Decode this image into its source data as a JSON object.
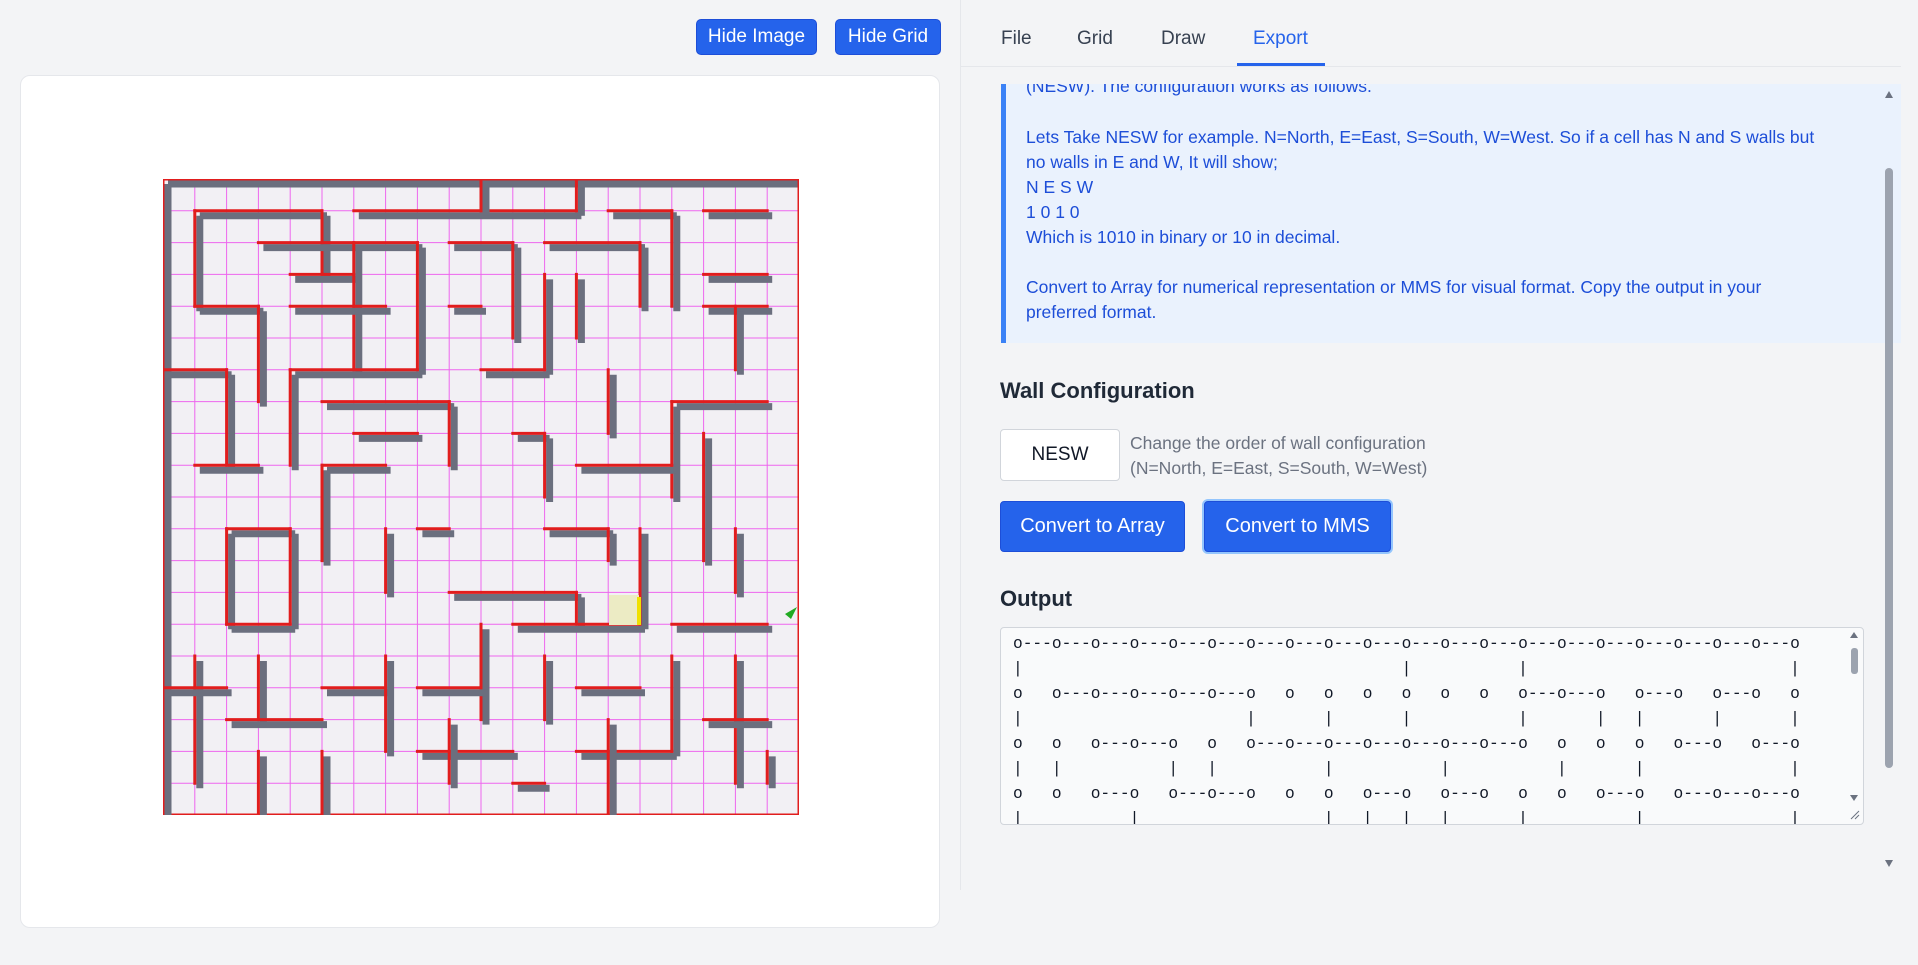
{
  "toolbar": {
    "hide_image_label": "Hide Image",
    "hide_grid_label": "Hide Grid"
  },
  "tabs": [
    {
      "label": "File",
      "active": false
    },
    {
      "label": "Grid",
      "active": false
    },
    {
      "label": "Draw",
      "active": false
    },
    {
      "label": "Export",
      "active": true
    }
  ],
  "info": {
    "line_clipped": "(NESW). The configuration works as follows.",
    "para1_line1": "Lets Take NESW for example. N=North, E=East, S=South, W=West. So if a cell has N and S walls but",
    "para1_line2": "no walls in E and W, It will show;",
    "para1_line3": "N E S W",
    "para1_line4": "1 0 1 0",
    "para1_line5": "Which is 1010 in binary or 10 in decimal.",
    "para2_line1": "Convert to Array for numerical representation or MMS for visual format. Copy the output in your",
    "para2_line2": "preferred format."
  },
  "wall_config": {
    "title": "Wall Configuration",
    "value": "NESW",
    "help_line1": "Change the order of wall configuration",
    "help_line2": "(N=North, E=East, S=South, W=West)"
  },
  "buttons": {
    "array_label": "Convert to Array",
    "mms_label": "Convert to MMS"
  },
  "output": {
    "title": "Output",
    "text": "o---o---o---o---o---o---o---o---o---o---o---o---o---o---o---o---o---o---o---o---o\n|                                       |           |                           |\no   o---o---o---o---o---o   o   o   o   o   o   o   o---o---o   o---o   o---o   o\n|                       |       |       |           |       |   |       |       |\no   o   o---o---o   o   o---o---o---o---o---o---o---o   o   o   o   o---o   o---o\n|   |           |   |           |           |           |       |               |\no   o   o---o   o---o---o   o   o   o---o   o---o   o   o   o---o   o---o---o---o\n|           |                   |   |   |   |       |           |               |"
  },
  "colors": {
    "accent": "#2563eb",
    "info_bg": "#eaf2fd",
    "info_text": "#1d4ed8",
    "maze_wall": "#e11d1d",
    "maze_grid": "#ee66ee"
  }
}
